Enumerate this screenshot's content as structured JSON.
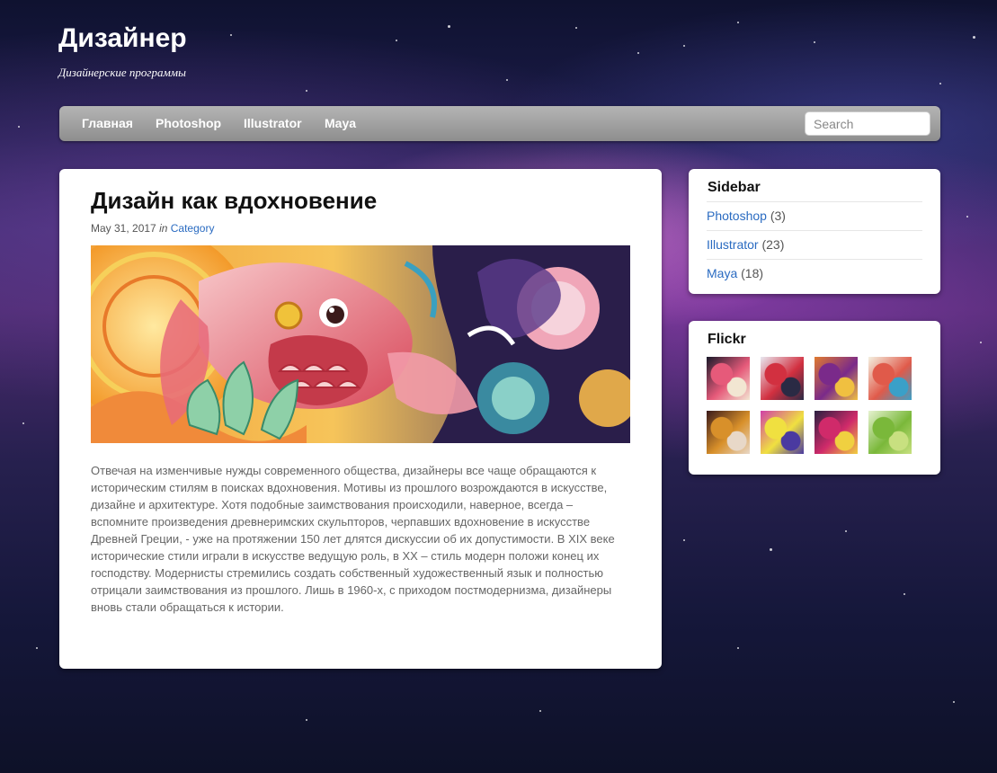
{
  "site": {
    "title": "Дизайнер",
    "description": "Дизайнерские программы"
  },
  "nav": {
    "items": [
      "Главная",
      "Photoshop",
      "Illustrator",
      "Maya"
    ],
    "search_placeholder": "Search"
  },
  "post": {
    "title": "Дизайн как вдохновение",
    "date": "May 31, 2017",
    "in_label": "in",
    "category": "Category",
    "image_name": "koi-fish-illustration",
    "body": "Отвечая на изменчивые нужды современного общества, дизайнеры все чаще обращаются к историческим стилям в поисках вдохновения. Мотивы из прошлого возрождаются в искусстве, дизайне и архитектуре. Хотя подобные заимствования происходили, наверное, всегда – вспомните произведения древнеримских скульпторов, черпавших вдохновение в искусстве Древней Греции, - уже на протяжении 150 лет длятся дискуссии об их допустимости. В XIX веке исторические стили играли в искусстве ведущую роль, в XX – стиль модерн положи конец их господству. Модернисты стремились создать собственный художественный язык и полностью отрицали заимствования из прошлого. Лишь в 1960-х, с приходом постмодернизма, дизайнеры вновь стали обращаться к истории."
  },
  "sidebar": {
    "title": "Sidebar",
    "items": [
      {
        "label": "Photoshop",
        "count": "(3)"
      },
      {
        "label": "Illustrator",
        "count": "(23)"
      },
      {
        "label": "Maya",
        "count": "(18)"
      }
    ]
  },
  "flickr": {
    "title": "Flickr",
    "thumbnails": [
      {
        "name": "flickr-thumb-1",
        "colors": [
          "#1a1a2a",
          "#e65a7a",
          "#f2e6d2"
        ]
      },
      {
        "name": "flickr-thumb-2",
        "colors": [
          "#e8e8f0",
          "#d23040",
          "#2a2a44"
        ]
      },
      {
        "name": "flickr-thumb-3",
        "colors": [
          "#e07a30",
          "#7a2a8a",
          "#f0c040"
        ]
      },
      {
        "name": "flickr-thumb-4",
        "colors": [
          "#f4f0e0",
          "#e05a4a",
          "#3aa0c8"
        ]
      },
      {
        "name": "flickr-thumb-5",
        "colors": [
          "#3a1a1a",
          "#d8902a",
          "#e8d8c8"
        ]
      },
      {
        "name": "flickr-thumb-6",
        "colors": [
          "#d040a8",
          "#f0e040",
          "#4a3aa0"
        ]
      },
      {
        "name": "flickr-thumb-7",
        "colors": [
          "#2a2040",
          "#d02a6a",
          "#f0d040"
        ]
      },
      {
        "name": "flickr-thumb-8",
        "colors": [
          "#e6f2d0",
          "#7ab83a",
          "#c8e080"
        ]
      }
    ]
  }
}
